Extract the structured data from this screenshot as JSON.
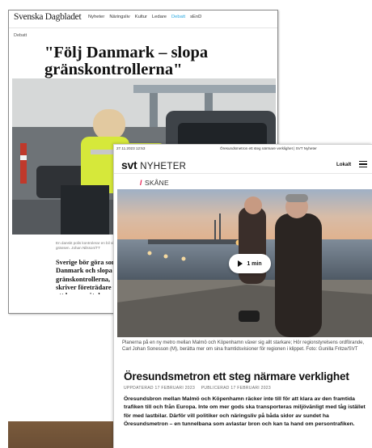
{
  "svd": {
    "logo": "Svenska Dagbladet",
    "menu": [
      "Nyheter",
      "Näringsliv",
      "Kultur",
      "Ledare",
      "Debatt",
      "sEnD"
    ],
    "active_menu_index": 4,
    "section": "Debatt",
    "headline": "\"Följ Danmark – slopa gränskontrollerna\"",
    "caption": "En danskt polis kontrolerar en bil vid gränsen. Johan Nilsson/TT",
    "lede": "Sverige bör göra som Danmark och slopa gränskontrollerna, skriver företrädare för att komma åt de problem som pendlare i Greater Copenhagen har."
  },
  "svt": {
    "print_date": "27.11.2023 12:53",
    "print_title": "Öresundsmetron ett steg närmare verklighet | SVT Nyheter",
    "logo_mark": "svt",
    "logo_text": "NYHETER",
    "lokalt_label": "Lokalt",
    "region": "SKÅNE",
    "video_duration": "1 min",
    "caption": "Planerna på en ny metro mellan Malmö och Köpenhamn växer sig allt starkare; Hör regionstyrelsens ordförande, Carl Johan Sonesson (M), berätta mer om sina framtidsvisioner för regionen i klippet. Foto: Gunilla Fritze/SVT",
    "headline": "Öresundsmetron ett steg närmare verklighet",
    "updated": "UPPDATERAD 17 FEBRUARI 2023",
    "published": "PUBLICERAD 17 FEBRUARI 2023",
    "lede": "Öresundsbron mellan Malmö och Köpenhamn räcker inte till för att klara av den framtida trafiken till och från Europa. Inte om mer gods ska transporteras miljövänligt med tåg istället för med lastbilar. Därför vill politiker och näringsliv på båda sidor av sundet ha Öresundsmetron – en tunnelbana som avlastar bron och kan ta hand om persontrafiken."
  },
  "colors": {
    "svt_red": "#e4003b",
    "svd_accent": "#2aa9e0"
  }
}
